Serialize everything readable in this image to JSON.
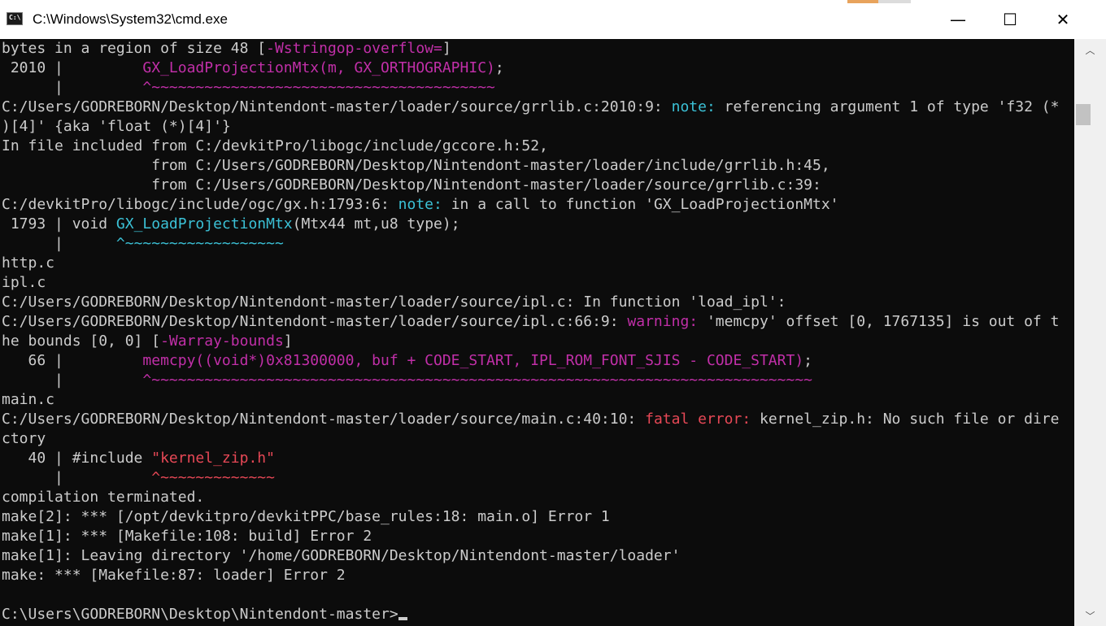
{
  "window": {
    "title": "C:\\Windows\\System32\\cmd.exe",
    "icon_label": "C:\\",
    "min_glyph": "—",
    "max_glyph": "☐",
    "close_glyph": "✕"
  },
  "scrollbar": {
    "up_glyph": "︿",
    "down_glyph": "﹀"
  },
  "console": {
    "lines": [
      [
        {
          "t": "bytes in a region of size 48 ["
        },
        {
          "t": "-Wstringop-overflow=",
          "c": "mag"
        },
        {
          "t": "]"
        }
      ],
      [
        {
          "t": " 2010 |         "
        },
        {
          "t": "GX_LoadProjectionMtx(m, GX_ORTHOGRAPHIC)",
          "c": "mag"
        },
        {
          "t": ";"
        }
      ],
      [
        {
          "t": "      |         "
        },
        {
          "t": "^~~~~~~~~~~~~~~~~~~~~~~~~~~~~~~~~~~~~~~~",
          "c": "mag"
        }
      ],
      [
        {
          "t": "C:/Users/GODREBORN/Desktop/Nintendont-master/loader/source/grrlib.c:2010:9: "
        },
        {
          "t": "note:",
          "c": "cyan"
        },
        {
          "t": " referencing argument 1 of type 'f32 (*"
        }
      ],
      [
        {
          "t": ")[4]' {aka 'float (*)[4]'}"
        }
      ],
      [
        {
          "t": "In file included from C:/devkitPro/libogc/include/gccore.h:52,"
        }
      ],
      [
        {
          "t": "                 from C:/Users/GODREBORN/Desktop/Nintendont-master/loader/include/grrlib.h:45,"
        }
      ],
      [
        {
          "t": "                 from C:/Users/GODREBORN/Desktop/Nintendont-master/loader/source/grrlib.c:39:"
        }
      ],
      [
        {
          "t": "C:/devkitPro/libogc/include/ogc/gx.h:1793:6: "
        },
        {
          "t": "note:",
          "c": "cyan"
        },
        {
          "t": " in a call to function 'GX_LoadProjectionMtx'"
        }
      ],
      [
        {
          "t": " 1793 | void "
        },
        {
          "t": "GX_LoadProjectionMtx",
          "c": "cyan"
        },
        {
          "t": "(Mtx44 mt,u8 type);"
        }
      ],
      [
        {
          "t": "      |      "
        },
        {
          "t": "^~~~~~~~~~~~~~~~~~~",
          "c": "cyan"
        }
      ],
      [
        {
          "t": "http.c"
        }
      ],
      [
        {
          "t": "ipl.c"
        }
      ],
      [
        {
          "t": "C:/Users/GODREBORN/Desktop/Nintendont-master/loader/source/ipl.c: In function 'load_ipl':"
        }
      ],
      [
        {
          "t": "C:/Users/GODREBORN/Desktop/Nintendont-master/loader/source/ipl.c:66:9: "
        },
        {
          "t": "warning:",
          "c": "mag"
        },
        {
          "t": " 'memcpy' offset [0, 1767135] is out of t"
        }
      ],
      [
        {
          "t": "he bounds [0, 0] ["
        },
        {
          "t": "-Warray-bounds",
          "c": "mag"
        },
        {
          "t": "]"
        }
      ],
      [
        {
          "t": "   66 |         "
        },
        {
          "t": "memcpy((void*)0x81300000, buf + CODE_START, IPL_ROM_FONT_SJIS - CODE_START)",
          "c": "mag"
        },
        {
          "t": ";"
        }
      ],
      [
        {
          "t": "      |         "
        },
        {
          "t": "^~~~~~~~~~~~~~~~~~~~~~~~~~~~~~~~~~~~~~~~~~~~~~~~~~~~~~~~~~~~~~~~~~~~~~~~~~~~",
          "c": "mag"
        }
      ],
      [
        {
          "t": "main.c"
        }
      ],
      [
        {
          "t": "C:/Users/GODREBORN/Desktop/Nintendont-master/loader/source/main.c:40:10: "
        },
        {
          "t": "fatal error:",
          "c": "red"
        },
        {
          "t": " kernel_zip.h: No such file or dire"
        }
      ],
      [
        {
          "t": "ctory"
        }
      ],
      [
        {
          "t": "   40 | #include "
        },
        {
          "t": "\"kernel_zip.h\"",
          "c": "red"
        }
      ],
      [
        {
          "t": "      |          "
        },
        {
          "t": "^~~~~~~~~~~~~~",
          "c": "red"
        }
      ],
      [
        {
          "t": "compilation terminated."
        }
      ],
      [
        {
          "t": "make[2]: *** [/opt/devkitpro/devkitPPC/base_rules:18: main.o] Error 1"
        }
      ],
      [
        {
          "t": "make[1]: *** [Makefile:108: build] Error 2"
        }
      ],
      [
        {
          "t": "make[1]: Leaving directory '/home/GODREBORN/Desktop/Nintendont-master/loader'"
        }
      ],
      [
        {
          "t": "make: *** [Makefile:87: loader] Error 2"
        }
      ],
      [
        {
          "t": ""
        }
      ],
      [
        {
          "t": "C:\\Users\\GODREBORN\\Desktop\\Nintendont-master>"
        }
      ]
    ]
  }
}
